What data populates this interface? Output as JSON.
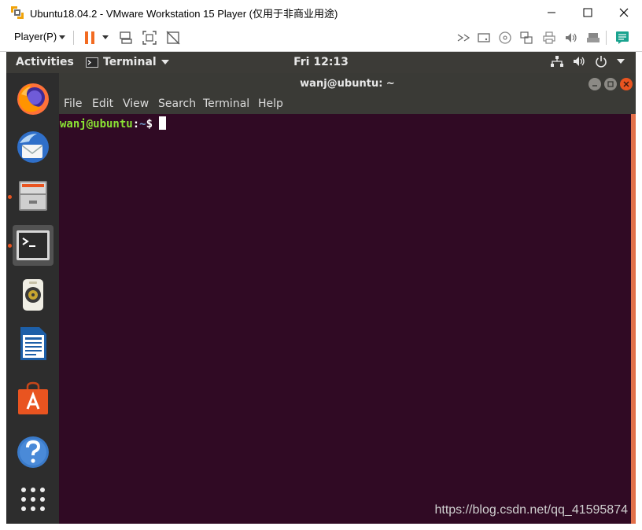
{
  "window": {
    "title": "Ubuntu18.04.2 - VMware Workstation 15 Player (仅用于非商业用途)",
    "icons": [
      "vmware-logo",
      "minimize-icon",
      "maximize-icon",
      "close-icon"
    ]
  },
  "vm_toolbar": {
    "player_menu": "Player(P)",
    "icons": [
      "pause-icon",
      "send-ctrl-alt-del-icon",
      "fit-guest-icon",
      "unity-icon",
      "network-icon",
      "hard-disk-icon",
      "cd-icon",
      "usb-icon",
      "printer-icon",
      "sound-icon",
      "device-icon",
      "message-icon"
    ]
  },
  "ubuntu_top_bar": {
    "activities": "Activities",
    "app_menu": "Terminal",
    "clock": "Fri 12:13",
    "status_icons": [
      "network-icon",
      "volume-icon",
      "power-icon"
    ]
  },
  "dock": {
    "items": [
      "Firefox",
      "Thunderbird",
      "Files",
      "Terminal",
      "Rhythmbox",
      "LibreOffice Writer",
      "Ubuntu Software",
      "Help",
      "Show Applications"
    ]
  },
  "terminal": {
    "title": "wanj@ubuntu: ~",
    "menu": [
      "File",
      "Edit",
      "View",
      "Search",
      "Terminal",
      "Help"
    ],
    "prompt_user": "wanj@ubuntu",
    "prompt_sep": ":",
    "prompt_path": "~",
    "prompt_symbol": "$"
  },
  "watermark": "https://blog.csdn.net/qq_41595874",
  "colors": {
    "terminal_bg": "#300a24",
    "ubuntu_orange": "#e95420",
    "prompt_user": "#8ae234",
    "prompt_path": "#729fcf"
  }
}
